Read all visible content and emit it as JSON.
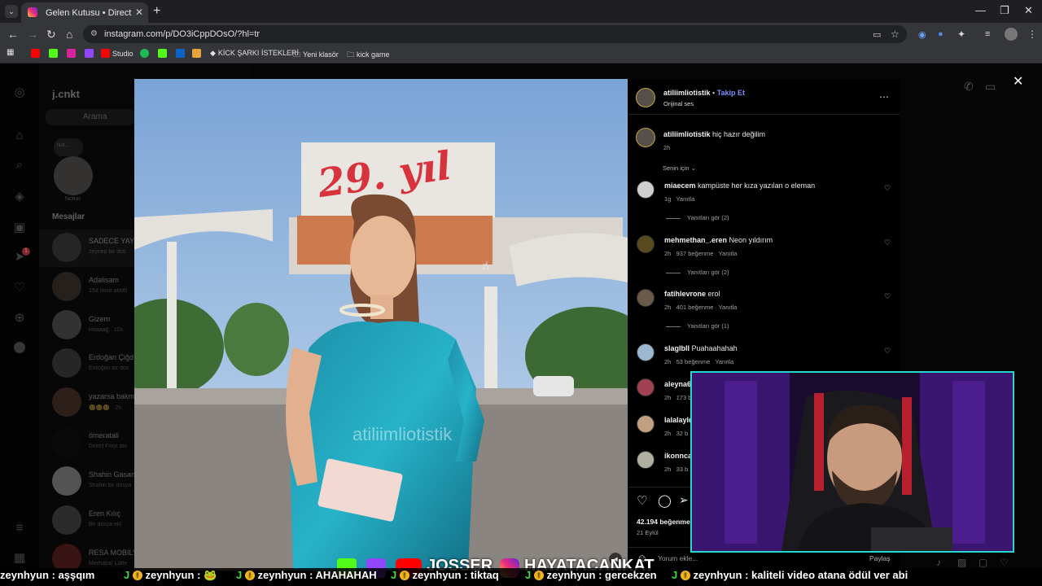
{
  "browser": {
    "tab_title": "Gelen Kutusu • Direct",
    "url": "instagram.com/p/DO3iCppDOsO/?hl=tr",
    "bookmarks": [
      "Studio",
      "KİCK ŞARKI İSTEKLERİ",
      "Yeni klasör",
      "kick game"
    ]
  },
  "inbox": {
    "username": "j.cnkt",
    "search_placeholder": "Arama",
    "note_label": "Notun",
    "note_bubble": "Not...",
    "messages_heading": "Mesajlar",
    "notification_count": "1",
    "conversations": [
      {
        "name": "SADECE YAYI",
        "sub": "zeynep bir dos"
      },
      {
        "name": "Adalisam",
        "sub": "15d önce aktifti"
      },
      {
        "name": "Gizem",
        "sub": "Haaaağ · 10s"
      },
      {
        "name": "Erdoğan Çiğd",
        "sub": "Erdoğan bir dos"
      },
      {
        "name": "yazarsa bakm",
        "sub": "🥺🥺🥺 · 2h"
      },
      {
        "name": "ömeratali",
        "sub": "Direct Fmyi ato"
      },
      {
        "name": "Shahin Gasan",
        "sub": "Shahin bir dosya"
      },
      {
        "name": "Eren Kılıç",
        "sub": "Bir dosya ekl"
      },
      {
        "name": "RESA MOBILY",
        "sub": "Merhaba! Lütfe"
      }
    ]
  },
  "video": {
    "sign_text": "29. yıl",
    "watermark": "atiliimliotistik"
  },
  "post": {
    "author": "atiliimliotistik",
    "follow_label": "Takip Et",
    "audio": "Orijinal ses",
    "caption_text": "hiç hazır değilim",
    "caption_time": "2h",
    "sort_label": "Senin için",
    "likes": "42.194 beğenme",
    "date": "21 Eylül",
    "comment_placeholder": "Yorum ekle...",
    "share_label": "Paylaş",
    "comments": [
      {
        "user": "miaecem",
        "text": "kampüste her kıza yazılan o eleman",
        "time": "1g",
        "likes": "",
        "reply": "Yanıtla",
        "replies": "Yanıtları gör (2)"
      },
      {
        "user": "mehmethan_.eren",
        "text": "Neon yıldırım",
        "time": "2h",
        "likes": "937 beğenme",
        "reply": "Yanıtla",
        "replies": "Yanıtları gör (2)"
      },
      {
        "user": "fatihlevrone",
        "text": "erol",
        "time": "2h",
        "likes": "401 beğenme",
        "reply": "Yanıtla",
        "replies": "Yanıtları gör (1)"
      },
      {
        "user": "slaglbll",
        "text": "Puahaahahah",
        "time": "2h",
        "likes": "53 beğenme",
        "reply": "Yanıtla",
        "replies": ""
      },
      {
        "user": "aleyna6",
        "text": "",
        "time": "2h",
        "likes": "173 b",
        "reply": "",
        "replies": ""
      },
      {
        "user": "lalalayld",
        "text": "",
        "time": "2h",
        "likes": "32 b",
        "reply": "",
        "replies": ""
      },
      {
        "user": "ikonnca",
        "text": "",
        "time": "2h",
        "likes": "33 b",
        "reply": "",
        "replies": ""
      }
    ]
  },
  "stream": {
    "overlay_names": [
      "JOSSER",
      "HAYATACANKAT"
    ],
    "chat": [
      {
        "user": "zeynhyun",
        "msg": ": aşşqım"
      },
      {
        "user": "zeynhyun",
        "msg": ": 🐸"
      },
      {
        "user": "zeynhyun",
        "msg": ": AHAHAHAH"
      },
      {
        "user": "zeynhyun",
        "msg": ": tiktaq"
      },
      {
        "user": "zeynhyun",
        "msg": ": gercekzen"
      },
      {
        "user": "zeynhyun",
        "msg": ": kaliteli video atana ödül ver abi"
      }
    ]
  },
  "colors": {
    "accent_blue": "#7c8cf8",
    "webcam_border": "#28d6d0",
    "chat_green": "#3ddc45"
  }
}
